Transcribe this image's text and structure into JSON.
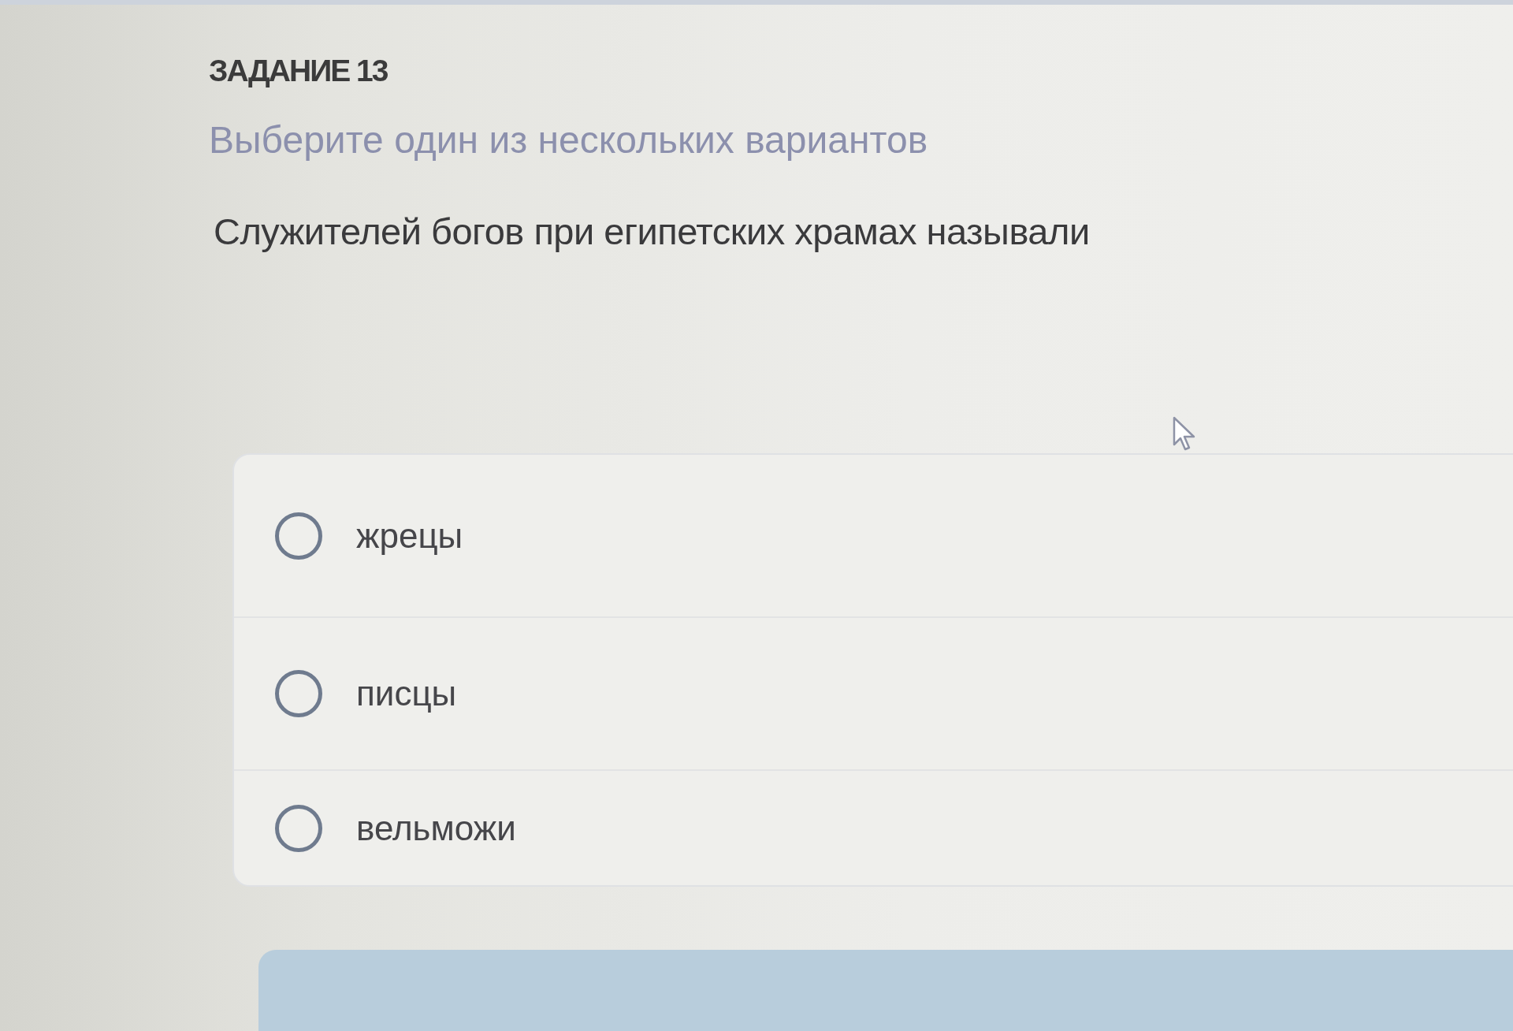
{
  "task": {
    "title": "ЗАДАНИЕ 13",
    "instruction": "Выберите один из нескольких вариантов",
    "question": "Служителей богов при египетских храмах называли"
  },
  "options": [
    {
      "label": "жрецы",
      "selected": false
    },
    {
      "label": "писцы",
      "selected": false
    },
    {
      "label": "вельможи",
      "selected": false
    }
  ]
}
